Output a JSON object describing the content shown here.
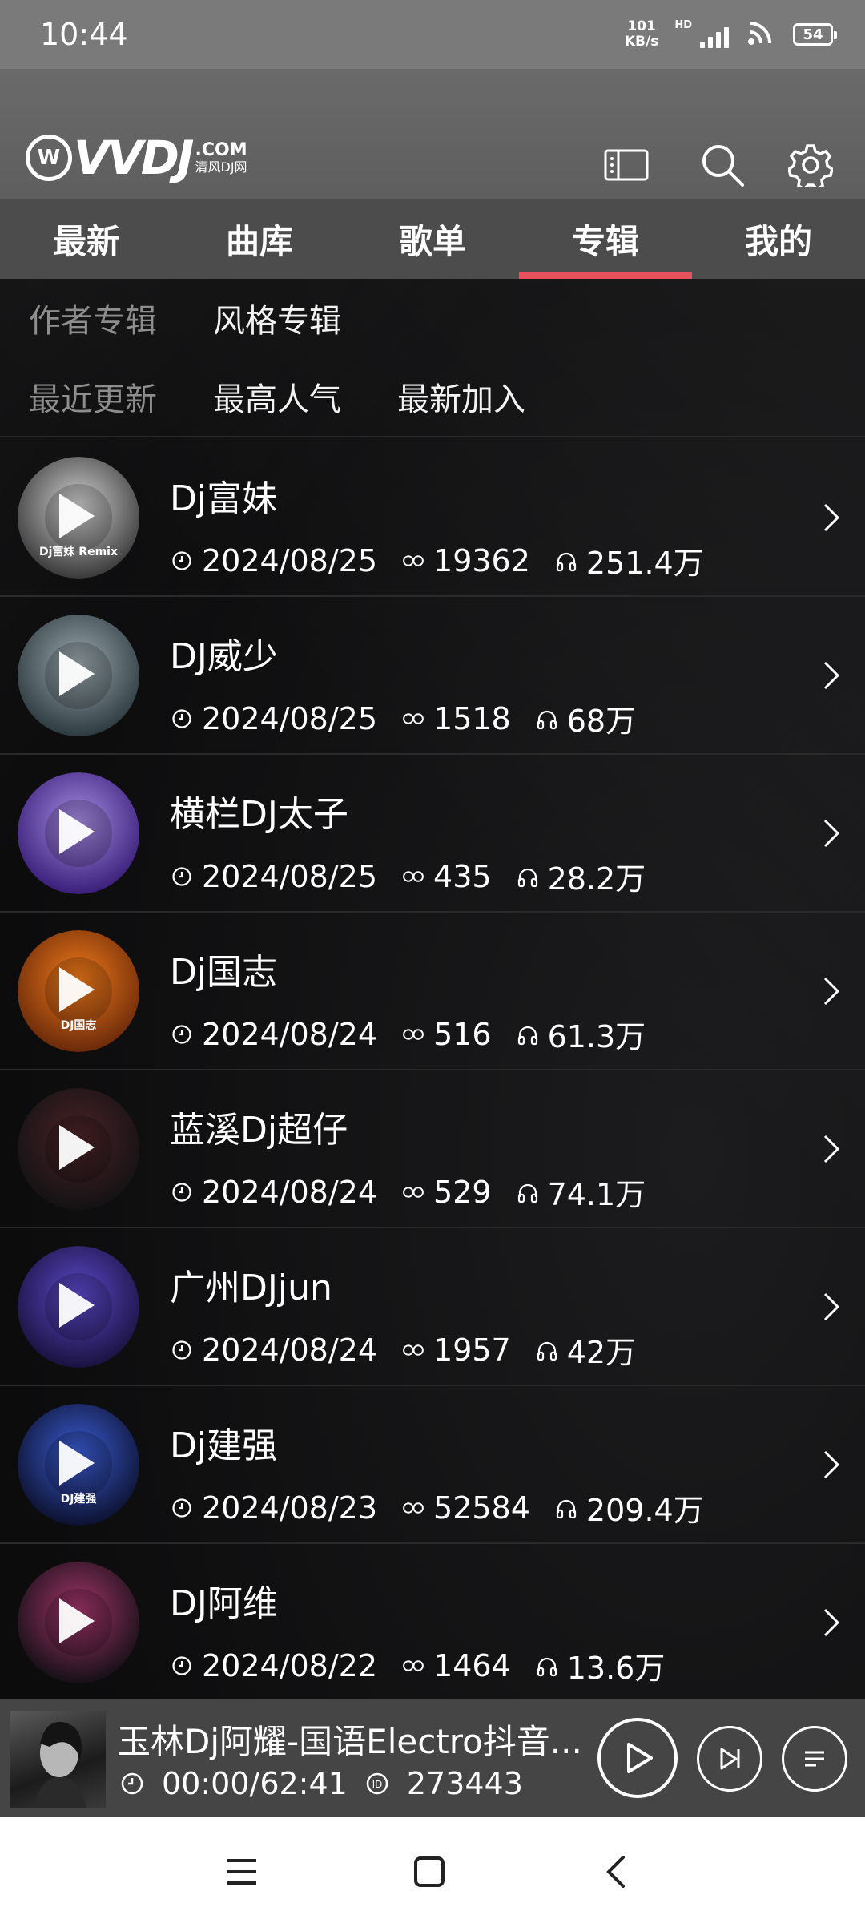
{
  "status_bar": {
    "time": "10:44",
    "net_speed_value": "101",
    "net_speed_unit": "KB/s",
    "network_badge": "HD",
    "battery": "54"
  },
  "header": {
    "logo_text": "VVDJ",
    "logo_domain": ".COM",
    "logo_sub": "清风DJ网"
  },
  "tabs": [
    {
      "label": "最新",
      "active": false
    },
    {
      "label": "曲库",
      "active": false
    },
    {
      "label": "歌单",
      "active": false
    },
    {
      "label": "专辑",
      "active": true
    },
    {
      "label": "我的",
      "active": false
    }
  ],
  "filters": {
    "row1": [
      "作者专辑",
      "风格专辑"
    ],
    "row2": [
      "最近更新",
      "最高人气",
      "最新加入"
    ],
    "active_row1": "风格专辑",
    "active_row2": "最近更新"
  },
  "albums": [
    {
      "title": "Dj富妹",
      "date": "2024/08/25",
      "count": "19362",
      "plays": "251.4万",
      "avatar_text": "Dj富妹 Remix",
      "colors": [
        "#cfcfcf",
        "#3a3a3a"
      ]
    },
    {
      "title": "DJ威少",
      "date": "2024/08/25",
      "count": "1518",
      "plays": "68万",
      "avatar_text": "",
      "colors": [
        "#9aa7ad",
        "#2d3a40"
      ]
    },
    {
      "title": "横栏DJ太子",
      "date": "2024/08/25",
      "count": "435",
      "plays": "28.2万",
      "avatar_text": "",
      "colors": [
        "#a58be0",
        "#3a1f7a"
      ]
    },
    {
      "title": "Dj国志",
      "date": "2024/08/24",
      "count": "516",
      "plays": "61.3万",
      "avatar_text": "DJ国志",
      "colors": [
        "#f07a1a",
        "#6b2a0a"
      ]
    },
    {
      "title": "蓝溪Dj超仔",
      "date": "2024/08/24",
      "count": "529",
      "plays": "74.1万",
      "avatar_text": "",
      "colors": [
        "#4a2226",
        "#131214"
      ]
    },
    {
      "title": "广州DJjun",
      "date": "2024/08/24",
      "count": "1957",
      "plays": "42万",
      "avatar_text": "",
      "colors": [
        "#5b48c9",
        "#1a123f"
      ]
    },
    {
      "title": "Dj建强",
      "date": "2024/08/23",
      "count": "52584",
      "plays": "209.4万",
      "avatar_text": "DJ建强",
      "colors": [
        "#3a5bd1",
        "#0d1230"
      ]
    },
    {
      "title": "DJ阿维",
      "date": "2024/08/22",
      "count": "1464",
      "plays": "13.6万",
      "avatar_text": "",
      "colors": [
        "#a2346a",
        "#151016"
      ]
    }
  ],
  "player": {
    "title": "玉林Dj阿耀-国语Electro抖音...",
    "time": "00:00/62:41",
    "id": "273443"
  },
  "icons": {
    "clock": "clock-icon",
    "infinity": "infinity-icon",
    "headphones": "headphones-icon",
    "chevron": "chevron-right-icon"
  },
  "colors": {
    "tab_indicator": "#e8505b",
    "header_bg": "#5e5e5e",
    "tabs_bg": "#4c4c4d",
    "player_bg": "#454546"
  }
}
